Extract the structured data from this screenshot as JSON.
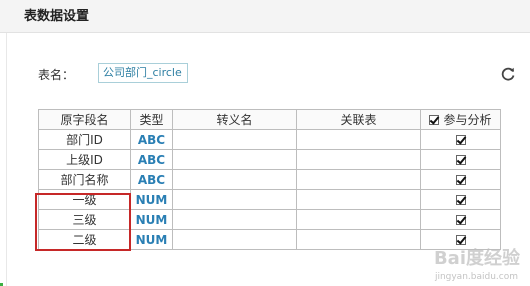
{
  "header": {
    "title": "表数据设置"
  },
  "form": {
    "name_label": "表名：",
    "name_value": "公司部门_circle"
  },
  "table": {
    "columns": {
      "source_field": "原字段名",
      "type": "类型",
      "alias": "转义名",
      "linked_table": "关联表",
      "analyze": "参与分析"
    },
    "header_checkbox_checked": true,
    "rows": [
      {
        "field": "部门ID",
        "type": "ABC",
        "alias": "",
        "linked": "",
        "checked": true
      },
      {
        "field": "上级ID",
        "type": "ABC",
        "alias": "",
        "linked": "",
        "checked": true
      },
      {
        "field": "部门名称",
        "type": "ABC",
        "alias": "",
        "linked": "",
        "checked": true
      },
      {
        "field": "一级",
        "type": "NUM",
        "alias": "",
        "linked": "",
        "checked": true
      },
      {
        "field": "三级",
        "type": "NUM",
        "alias": "",
        "linked": "",
        "checked": true
      },
      {
        "field": "二级",
        "type": "NUM",
        "alias": "",
        "linked": "",
        "checked": true
      }
    ]
  },
  "watermark": {
    "text": "Bai度经验",
    "sub": "jingyan.baidu.com"
  },
  "colors": {
    "type_badge": "#2a7fb4",
    "highlight": "#c62828",
    "input_border": "#a9cfd9"
  },
  "icons": {
    "refresh": "refresh-icon"
  }
}
